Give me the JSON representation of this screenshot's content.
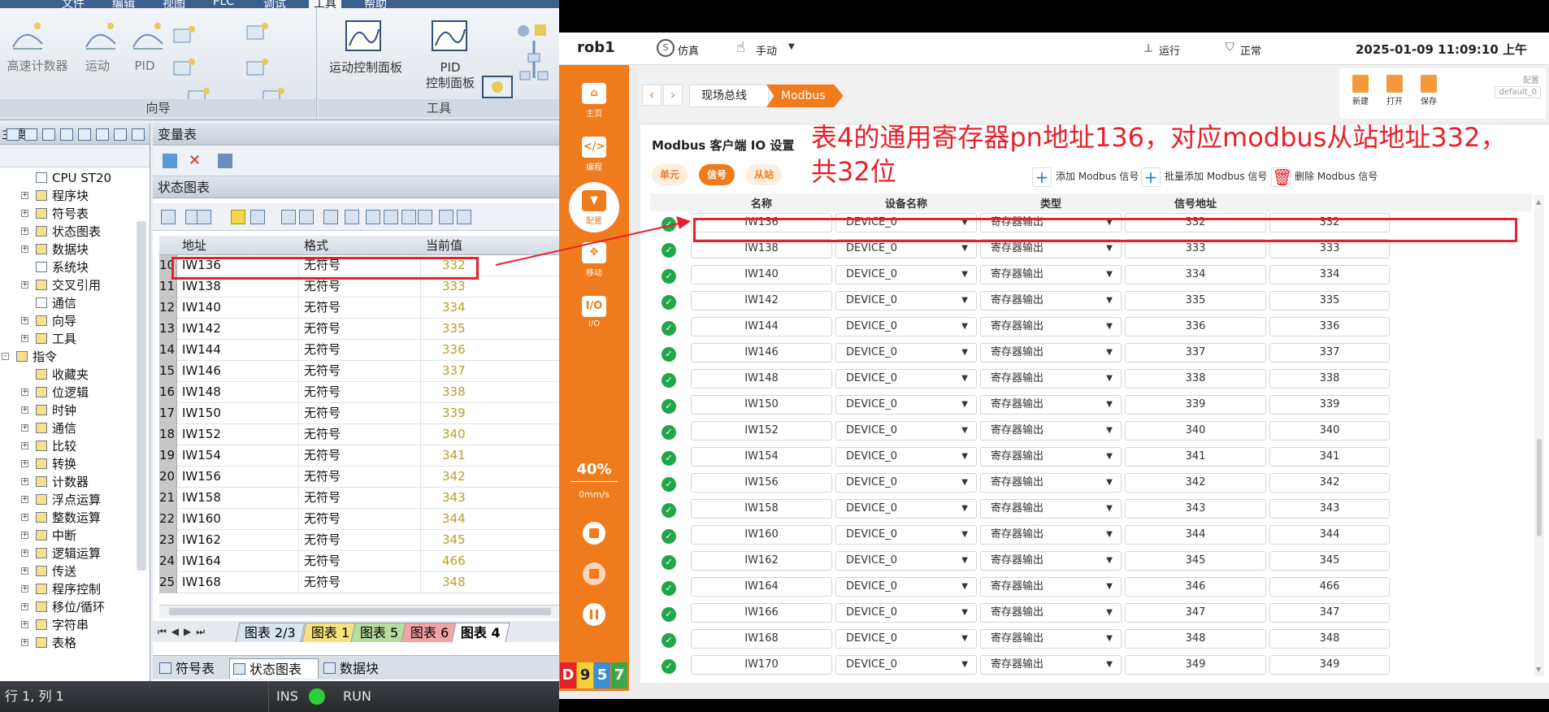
{
  "left_app": {
    "menu": [
      "文件",
      "编辑",
      "视图",
      "PLC",
      "调试",
      "工具",
      "帮助"
    ],
    "menu_active_index": 5,
    "ribbon": {
      "wizard_group_label": "向导",
      "tools_group_label": "工具",
      "wizard_buttons": [
        "高速计数器",
        "运动",
        "PID"
      ],
      "tools_buttons": [
        {
          "line1": "运动控制面板",
          "line2": ""
        },
        {
          "line1": "PID",
          "line2": "控制面板"
        }
      ]
    },
    "tree": {
      "header": "主要",
      "pin": "ф",
      "items": [
        {
          "label": "CPU ST20",
          "indent": 2,
          "exp": ""
        },
        {
          "label": "程序块",
          "indent": 2,
          "exp": "+"
        },
        {
          "label": "符号表",
          "indent": 2,
          "exp": "+"
        },
        {
          "label": "状态图表",
          "indent": 2,
          "exp": "+"
        },
        {
          "label": "数据块",
          "indent": 2,
          "exp": "+"
        },
        {
          "label": "系统块",
          "indent": 2,
          "exp": ""
        },
        {
          "label": "交叉引用",
          "indent": 2,
          "exp": "+"
        },
        {
          "label": "通信",
          "indent": 2,
          "exp": ""
        },
        {
          "label": "向导",
          "indent": 2,
          "exp": "+"
        },
        {
          "label": "工具",
          "indent": 2,
          "exp": "+"
        },
        {
          "label": "指令",
          "indent": 1,
          "exp": "-"
        },
        {
          "label": "收藏夹",
          "indent": 2,
          "exp": ""
        },
        {
          "label": "位逻辑",
          "indent": 2,
          "exp": "+"
        },
        {
          "label": "时钟",
          "indent": 2,
          "exp": "+"
        },
        {
          "label": "通信",
          "indent": 2,
          "exp": "+"
        },
        {
          "label": "比较",
          "indent": 2,
          "exp": "+"
        },
        {
          "label": "转换",
          "indent": 2,
          "exp": "+"
        },
        {
          "label": "计数器",
          "indent": 2,
          "exp": "+"
        },
        {
          "label": "浮点运算",
          "indent": 2,
          "exp": "+"
        },
        {
          "label": "整数运算",
          "indent": 2,
          "exp": "+"
        },
        {
          "label": "中断",
          "indent": 2,
          "exp": "+"
        },
        {
          "label": "逻辑运算",
          "indent": 2,
          "exp": "+"
        },
        {
          "label": "传送",
          "indent": 2,
          "exp": "+"
        },
        {
          "label": "程序控制",
          "indent": 2,
          "exp": "+"
        },
        {
          "label": "移位/循环",
          "indent": 2,
          "exp": "+"
        },
        {
          "label": "字符串",
          "indent": 2,
          "exp": "+"
        },
        {
          "label": "表格",
          "indent": 2,
          "exp": "+"
        }
      ]
    },
    "var_table_title": "变量表",
    "status_chart_title": "状态图表",
    "status_table": {
      "headers": [
        "地址",
        "格式",
        "当前值"
      ],
      "rows": [
        {
          "n": "10",
          "addr": "IW136",
          "fmt": "无符号",
          "val": "332"
        },
        {
          "n": "11",
          "addr": "IW138",
          "fmt": "无符号",
          "val": "333"
        },
        {
          "n": "12",
          "addr": "IW140",
          "fmt": "无符号",
          "val": "334"
        },
        {
          "n": "13",
          "addr": "IW142",
          "fmt": "无符号",
          "val": "335"
        },
        {
          "n": "14",
          "addr": "IW144",
          "fmt": "无符号",
          "val": "336"
        },
        {
          "n": "15",
          "addr": "IW146",
          "fmt": "无符号",
          "val": "337"
        },
        {
          "n": "16",
          "addr": "IW148",
          "fmt": "无符号",
          "val": "338"
        },
        {
          "n": "17",
          "addr": "IW150",
          "fmt": "无符号",
          "val": "339"
        },
        {
          "n": "18",
          "addr": "IW152",
          "fmt": "无符号",
          "val": "340"
        },
        {
          "n": "19",
          "addr": "IW154",
          "fmt": "无符号",
          "val": "341"
        },
        {
          "n": "20",
          "addr": "IW156",
          "fmt": "无符号",
          "val": "342"
        },
        {
          "n": "21",
          "addr": "IW158",
          "fmt": "无符号",
          "val": "343"
        },
        {
          "n": "22",
          "addr": "IW160",
          "fmt": "无符号",
          "val": "344"
        },
        {
          "n": "23",
          "addr": "IW162",
          "fmt": "无符号",
          "val": "345"
        },
        {
          "n": "24",
          "addr": "IW164",
          "fmt": "无符号",
          "val": "466"
        },
        {
          "n": "25",
          "addr": "IW168",
          "fmt": "无符号",
          "val": "348"
        }
      ]
    },
    "sheet_tabs": [
      {
        "label": "图表 2/3",
        "color": "#d9e4f0"
      },
      {
        "label": "图表 1",
        "color": "#f6e27a"
      },
      {
        "label": "图表 5",
        "color": "#b6dca0"
      },
      {
        "label": "图表 6",
        "color": "#f2a4a4"
      },
      {
        "label": "图表 4",
        "color": "#ffffff"
      }
    ],
    "bottom_tabs": [
      "符号表",
      "状态图表",
      "数据块"
    ],
    "statusbar": {
      "pos": "行 1, 列 1",
      "ins": "INS",
      "run": "RUN"
    }
  },
  "robot_app": {
    "robot_name": "rob1",
    "mode_sim": "仿真",
    "mode_manual": "手动",
    "state_run": "运行",
    "state_normal": "正常",
    "datetime": "2025-01-09 11:09:10 上午",
    "nav": [
      "主页",
      "编程",
      "配置",
      "移动",
      "I/O"
    ],
    "nav_icons": [
      "⌂",
      "</>",
      "▼",
      "✥",
      "I/O"
    ],
    "speed_pct": "40%",
    "speed_val": "0mm/s",
    "badges": [
      "D",
      "9",
      "5",
      "7"
    ],
    "badge_colors": [
      "#e8202a",
      "#f6d23a",
      "#3b8fd6",
      "#3aa84a"
    ],
    "breadcrumb": [
      "现场总线",
      "Modbus"
    ],
    "toolbar": [
      "新建",
      "打开",
      "保存"
    ],
    "config_label": "配置",
    "config_value": "default_0",
    "section_title": "Modbus 客户端 IO 设置",
    "subtabs": [
      "单元",
      "信号",
      "从站"
    ],
    "subtab_active": 1,
    "actions": [
      "添加 Modbus 信号",
      "批量添加 Modbus 信号",
      "删除 Modbus 信号"
    ],
    "grid_headers": [
      "名称",
      "设备名称",
      "类型",
      "信号地址"
    ],
    "rows": [
      {
        "name": "IW136",
        "dev": "DEVICE_0",
        "type": "寄存器输出",
        "addr": "332",
        "val": "332"
      },
      {
        "name": "IW138",
        "dev": "DEVICE_0",
        "type": "寄存器输出",
        "addr": "333",
        "val": "333"
      },
      {
        "name": "IW140",
        "dev": "DEVICE_0",
        "type": "寄存器输出",
        "addr": "334",
        "val": "334"
      },
      {
        "name": "IW142",
        "dev": "DEVICE_0",
        "type": "寄存器输出",
        "addr": "335",
        "val": "335"
      },
      {
        "name": "IW144",
        "dev": "DEVICE_0",
        "type": "寄存器输出",
        "addr": "336",
        "val": "336"
      },
      {
        "name": "IW146",
        "dev": "DEVICE_0",
        "type": "寄存器输出",
        "addr": "337",
        "val": "337"
      },
      {
        "name": "IW148",
        "dev": "DEVICE_0",
        "type": "寄存器输出",
        "addr": "338",
        "val": "338"
      },
      {
        "name": "IW150",
        "dev": "DEVICE_0",
        "type": "寄存器输出",
        "addr": "339",
        "val": "339"
      },
      {
        "name": "IW152",
        "dev": "DEVICE_0",
        "type": "寄存器输出",
        "addr": "340",
        "val": "340"
      },
      {
        "name": "IW154",
        "dev": "DEVICE_0",
        "type": "寄存器输出",
        "addr": "341",
        "val": "341"
      },
      {
        "name": "IW156",
        "dev": "DEVICE_0",
        "type": "寄存器输出",
        "addr": "342",
        "val": "342"
      },
      {
        "name": "IW158",
        "dev": "DEVICE_0",
        "type": "寄存器输出",
        "addr": "343",
        "val": "343"
      },
      {
        "name": "IW160",
        "dev": "DEVICE_0",
        "type": "寄存器输出",
        "addr": "344",
        "val": "344"
      },
      {
        "name": "IW162",
        "dev": "DEVICE_0",
        "type": "寄存器输出",
        "addr": "345",
        "val": "345"
      },
      {
        "name": "IW164",
        "dev": "DEVICE_0",
        "type": "寄存器输出",
        "addr": "346",
        "val": "466"
      },
      {
        "name": "IW166",
        "dev": "DEVICE_0",
        "type": "寄存器输出",
        "addr": "347",
        "val": "347"
      },
      {
        "name": "IW168",
        "dev": "DEVICE_0",
        "type": "寄存器输出",
        "addr": "348",
        "val": "348"
      },
      {
        "name": "IW170",
        "dev": "DEVICE_0",
        "type": "寄存器输出",
        "addr": "349",
        "val": "349"
      }
    ],
    "accent": "#f07b1c"
  },
  "annotation": {
    "text": "表4的通用寄存器pn地址136，对应modbus从站地址332，共32位",
    "color": "#e8202a"
  }
}
